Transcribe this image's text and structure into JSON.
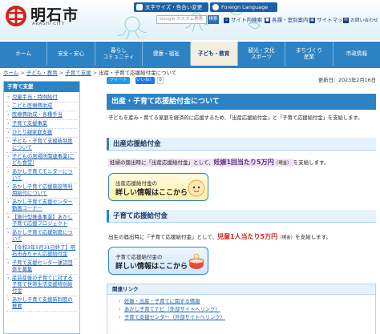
{
  "header": {
    "logo_text": "明石市",
    "logo_sub": "AKASHI CITY",
    "fontsize_label": "文字サイズ・色合い変更",
    "foreign_label": "Foreign Language",
    "search_placeholder": "Google カスタム検索",
    "search_button": "検索",
    "links": [
      {
        "label": "サイト内検索",
        "icon": "search-icon"
      },
      {
        "label": "各課・室別案内",
        "icon": "building-icon"
      },
      {
        "label": "サイトマップ",
        "icon": "sitemap-icon"
      },
      {
        "label": "お問い合わせ",
        "icon": "mail-icon"
      }
    ]
  },
  "nav": {
    "items": [
      {
        "label": "ホーム",
        "active": false
      },
      {
        "label": "安全・安心",
        "active": false
      },
      {
        "label": "暮らし\nコミュニティ",
        "active": false
      },
      {
        "label": "健康・福祉",
        "active": false
      },
      {
        "label": "子ども・教育",
        "active": true
      },
      {
        "label": "観光・文化\nスポーツ",
        "active": false
      },
      {
        "label": "まちづくり\n産業",
        "active": false
      },
      {
        "label": "市政情報",
        "active": false
      }
    ]
  },
  "breadcrumb": {
    "items": [
      "ホーム",
      "子ども・教育",
      "子育て支援",
      "出産・子育て応援給付金について"
    ]
  },
  "sidebar": {
    "heading": "子育て支援",
    "items": [
      "児童手当・特例給付",
      "こども医療費助成",
      "医療費助成・各種手当",
      "子育て支援事業",
      "ひとり親家庭支援",
      "子ども・子育て支援新制度について",
      "子どもの居場所関連事業(こども食堂)",
      "あかし子育てモニターについて",
      "あかし子育て応援施設等利用給付について",
      "あかし子育て支援センター動画コーナー",
      "【施行型推進事業】あかし子育て応援プロジェクト",
      "あかし子育て応援制度について",
      "【令和3年5月31日終了】明石市赤ちゃん応援給付金",
      "子育て支援センター運営団体を募集",
      "産前産後の子育てに対する子育て世帯生活支援特別給付金",
      "あかし子育て支援新制度の概要"
    ]
  },
  "main": {
    "tweet_label": "ツイート",
    "like_label": "いいね！",
    "like_count": "0",
    "updated": "更新日：2023年2月16日",
    "title": "出産・子育て応援給付金について",
    "intro": "子どもを産み・育てる家庭を経済的に応援するため、「出産応援給付金」と「子育て応援給付金」を支給します。",
    "section1": {
      "heading": "出産応援給付金",
      "text_pre": "妊婦の届出時に「出産応援給付金」として、",
      "text_big": "妊娠1回当たり5万円",
      "text_note": "（現金）",
      "text_post": "を支給します。",
      "button_line1": "出産応援給付金の",
      "button_line2": "詳しい情報はここから"
    },
    "section2": {
      "heading": "子育て応援給付金",
      "text_pre": "出生の届出時に「子育て応援給付金」として、",
      "text_big": "児童1人当たり5万円",
      "text_note": "（現金）",
      "text_post": "を支給します。",
      "button_line1": "子育て応援給付金の",
      "button_line2": "詳しい情報はここから"
    },
    "related": {
      "heading": "関連リンク",
      "items": [
        "妊娠・出産・子育てに関する情報",
        "あかし子育てナビ（外部サイトへリンク）",
        "子育て支援センター（外部サイトへリンク）"
      ]
    }
  },
  "colors": {
    "brand_blue": "#2d82c4",
    "nav_active_bg": "#f2efe1",
    "accent_red": "#d3231c",
    "accent_purple": "#5b2b82",
    "logo_red": "#d3231c"
  }
}
